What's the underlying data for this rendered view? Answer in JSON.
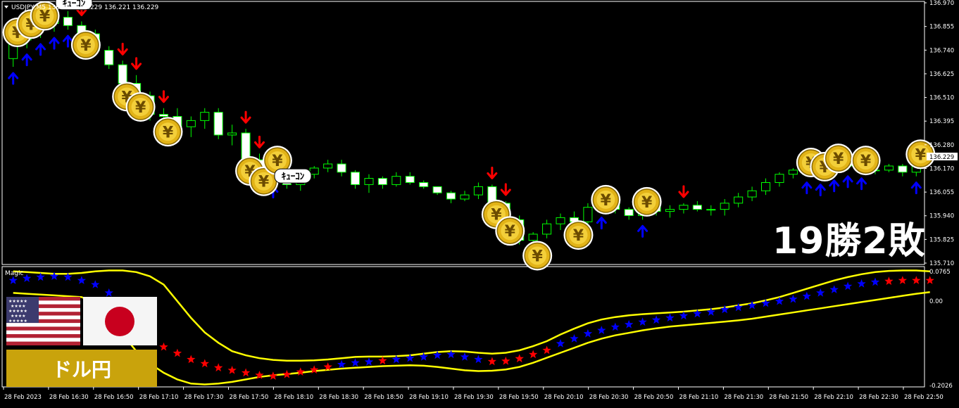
{
  "symbol_header": "USDJPY,M5  136.222 136.229 136.221 136.229",
  "main_price_labels": [
    "136.970",
    "136.855",
    "136.740",
    "136.625",
    "136.510",
    "136.395",
    "136.280",
    "136.170",
    "136.055",
    "135.940",
    "135.825",
    "135.710"
  ],
  "current_price": "136.229",
  "indicator_name": "Magic",
  "indicator_labels": [
    "0.0765",
    "0.00",
    "-0.2026"
  ],
  "time_labels": [
    "28 Feb 2023",
    "28 Feb 16:30",
    "28 Feb 16:50",
    "28 Feb 17:10",
    "28 Feb 17:30",
    "28 Feb 17:50",
    "28 Feb 18:10",
    "28 Feb 18:30",
    "28 Feb 18:50",
    "28 Feb 19:10",
    "28 Feb 19:30",
    "28 Feb 19:50",
    "28 Feb 20:10",
    "28 Feb 20:30",
    "28 Feb 20:50",
    "28 Feb 21:10",
    "28 Feb 21:30",
    "28 Feb 21:50",
    "28 Feb 22:10",
    "28 Feb 22:30",
    "28 Feb 22:50"
  ],
  "result_text": "19勝2敗",
  "pair_badge": "ドル円",
  "coin_symbol": "¥",
  "coin_caption": "ｷｭｰｺﾝ",
  "colors": {
    "background": "#000000",
    "candle_up": "#00ff00",
    "candle_down_fill": "#ffffff",
    "buy_arrow": "#0000ff",
    "sell_arrow": "#ff0000",
    "band": "#ffff00",
    "badge": "#c9a30c"
  },
  "chart_data": {
    "type": "candlestick",
    "y_range": [
      135.71,
      136.97
    ],
    "candles": [
      [
        136.7,
        136.82,
        136.66,
        136.79
      ],
      [
        136.79,
        136.86,
        136.75,
        136.84
      ],
      [
        136.84,
        136.9,
        136.8,
        136.87
      ],
      [
        136.87,
        136.93,
        136.83,
        136.9
      ],
      [
        136.9,
        136.93,
        136.84,
        136.86
      ],
      [
        136.86,
        136.88,
        136.8,
        136.82
      ],
      [
        136.82,
        136.84,
        136.72,
        136.74
      ],
      [
        136.74,
        136.76,
        136.65,
        136.67
      ],
      [
        136.67,
        136.69,
        136.55,
        136.58
      ],
      [
        136.58,
        136.62,
        136.5,
        136.52
      ],
      [
        136.52,
        136.54,
        136.4,
        136.43
      ],
      [
        136.43,
        136.46,
        136.38,
        136.42
      ],
      [
        136.42,
        136.46,
        136.33,
        136.37
      ],
      [
        136.37,
        136.42,
        136.32,
        136.4
      ],
      [
        136.4,
        136.46,
        136.36,
        136.44
      ],
      [
        136.44,
        136.46,
        136.31,
        136.33
      ],
      [
        136.33,
        136.38,
        136.28,
        136.34
      ],
      [
        136.34,
        136.36,
        136.19,
        136.21
      ],
      [
        136.21,
        136.24,
        136.14,
        136.16
      ],
      [
        136.16,
        136.2,
        136.11,
        136.14
      ],
      [
        136.14,
        136.16,
        136.07,
        136.09
      ],
      [
        136.09,
        136.16,
        136.06,
        136.14
      ],
      [
        136.14,
        136.18,
        136.12,
        136.17
      ],
      [
        136.17,
        136.21,
        136.15,
        136.19
      ],
      [
        136.19,
        136.21,
        136.13,
        136.15
      ],
      [
        136.15,
        136.16,
        136.07,
        136.09
      ],
      [
        136.09,
        136.14,
        136.05,
        136.12
      ],
      [
        136.12,
        136.13,
        136.07,
        136.09
      ],
      [
        136.09,
        136.15,
        136.08,
        136.13
      ],
      [
        136.13,
        136.15,
        136.09,
        136.1
      ],
      [
        136.1,
        136.11,
        136.07,
        136.08
      ],
      [
        136.08,
        136.08,
        136.04,
        136.05
      ],
      [
        136.05,
        136.06,
        136.0,
        136.02
      ],
      [
        136.02,
        136.06,
        136.01,
        136.04
      ],
      [
        136.04,
        136.1,
        136.02,
        136.08
      ],
      [
        136.08,
        136.09,
        135.98,
        136.0
      ],
      [
        136.0,
        136.01,
        135.9,
        135.92
      ],
      [
        135.92,
        135.94,
        135.8,
        135.82
      ],
      [
        135.82,
        135.86,
        135.78,
        135.85
      ],
      [
        135.85,
        135.92,
        135.83,
        135.9
      ],
      [
        135.9,
        135.95,
        135.87,
        135.93
      ],
      [
        135.93,
        135.96,
        135.88,
        135.91
      ],
      [
        135.91,
        136.0,
        135.9,
        135.98
      ],
      [
        135.98,
        136.01,
        135.96,
        136.0
      ],
      [
        136.0,
        136.01,
        135.95,
        135.97
      ],
      [
        135.97,
        135.98,
        135.92,
        135.94
      ],
      [
        135.94,
        136.0,
        135.92,
        135.99
      ],
      [
        135.99,
        136.0,
        135.94,
        135.96
      ],
      [
        135.96,
        135.99,
        135.93,
        135.97
      ],
      [
        135.97,
        136.0,
        135.95,
        135.99
      ],
      [
        135.99,
        136.01,
        135.96,
        135.97
      ],
      [
        135.97,
        135.99,
        135.94,
        135.97
      ],
      [
        135.97,
        136.02,
        135.94,
        136.0
      ],
      [
        136.0,
        136.05,
        135.98,
        136.03
      ],
      [
        136.03,
        136.08,
        136.01,
        136.06
      ],
      [
        136.06,
        136.12,
        136.04,
        136.1
      ],
      [
        136.1,
        136.15,
        136.08,
        136.14
      ],
      [
        136.14,
        136.17,
        136.12,
        136.16
      ],
      [
        136.16,
        136.19,
        136.13,
        136.14
      ],
      [
        136.14,
        136.17,
        136.12,
        136.16
      ],
      [
        136.16,
        136.21,
        136.14,
        136.19
      ],
      [
        136.19,
        136.23,
        136.16,
        136.18
      ],
      [
        136.18,
        136.2,
        136.15,
        136.16
      ],
      [
        136.16,
        136.18,
        136.14,
        136.16
      ],
      [
        136.16,
        136.19,
        136.15,
        136.18
      ],
      [
        136.18,
        136.19,
        136.13,
        136.15
      ],
      [
        136.15,
        136.23,
        136.13,
        136.2
      ]
    ],
    "buy_signal_indices": [
      0,
      1,
      2,
      3,
      4,
      19,
      43,
      46,
      58,
      59,
      60,
      61,
      62,
      66
    ],
    "sell_signal_indices": [
      5,
      8,
      9,
      11,
      17,
      18,
      35,
      36,
      49
    ],
    "indicator_range": [
      -0.2026,
      0.0765
    ],
    "indicator_values": [
      0.05,
      0.055,
      0.058,
      0.06,
      0.058,
      0.05,
      0.04,
      0.02,
      -0.02,
      -0.06,
      -0.09,
      -0.11,
      -0.125,
      -0.14,
      -0.15,
      -0.16,
      -0.166,
      -0.172,
      -0.178,
      -0.18,
      -0.176,
      -0.17,
      -0.165,
      -0.158,
      -0.152,
      -0.148,
      -0.146,
      -0.143,
      -0.14,
      -0.137,
      -0.134,
      -0.13,
      -0.128,
      -0.134,
      -0.14,
      -0.145,
      -0.144,
      -0.138,
      -0.128,
      -0.118,
      -0.102,
      -0.09,
      -0.078,
      -0.07,
      -0.062,
      -0.056,
      -0.05,
      -0.045,
      -0.04,
      -0.035,
      -0.03,
      -0.026,
      -0.02,
      -0.015,
      -0.01,
      -0.005,
      0.0,
      0.005,
      0.012,
      0.02,
      0.028,
      0.036,
      0.042,
      0.046,
      0.048,
      0.05,
      0.05,
      0.05
    ],
    "indicator_star_colors_red_indices": [
      8,
      9,
      10,
      11,
      12,
      13,
      14,
      15,
      16,
      17,
      18,
      19,
      20,
      21,
      22,
      23,
      27,
      35,
      36,
      37,
      38,
      39,
      64,
      65,
      66,
      67
    ],
    "upper_band": [
      0.072,
      0.07,
      0.068,
      0.066,
      0.066,
      0.068,
      0.072,
      0.074,
      0.074,
      0.07,
      0.06,
      0.04,
      0.0,
      -0.04,
      -0.075,
      -0.1,
      -0.12,
      -0.13,
      -0.137,
      -0.141,
      -0.143,
      -0.143,
      -0.142,
      -0.14,
      -0.137,
      -0.134,
      -0.133,
      -0.133,
      -0.132,
      -0.13,
      -0.126,
      -0.122,
      -0.12,
      -0.121,
      -0.124,
      -0.126,
      -0.124,
      -0.118,
      -0.108,
      -0.096,
      -0.08,
      -0.066,
      -0.053,
      -0.044,
      -0.038,
      -0.034,
      -0.031,
      -0.029,
      -0.027,
      -0.025,
      -0.022,
      -0.019,
      -0.015,
      -0.01,
      -0.005,
      0.002,
      0.01,
      0.02,
      0.03,
      0.04,
      0.05,
      0.058,
      0.065,
      0.07,
      0.073,
      0.074,
      0.074,
      0.072
    ],
    "lower_band": [
      0.02,
      0.018,
      0.016,
      0.014,
      0.012,
      0.01,
      -0.005,
      -0.04,
      -0.08,
      -0.12,
      -0.15,
      -0.172,
      -0.188,
      -0.198,
      -0.2,
      -0.198,
      -0.194,
      -0.188,
      -0.182,
      -0.178,
      -0.175,
      -0.172,
      -0.168,
      -0.165,
      -0.162,
      -0.16,
      -0.158,
      -0.156,
      -0.155,
      -0.154,
      -0.155,
      -0.158,
      -0.162,
      -0.166,
      -0.168,
      -0.167,
      -0.164,
      -0.158,
      -0.148,
      -0.136,
      -0.124,
      -0.112,
      -0.1,
      -0.09,
      -0.082,
      -0.076,
      -0.07,
      -0.065,
      -0.061,
      -0.058,
      -0.055,
      -0.052,
      -0.049,
      -0.046,
      -0.042,
      -0.037,
      -0.032,
      -0.027,
      -0.022,
      -0.017,
      -0.012,
      -0.007,
      -0.002,
      0.003,
      0.008,
      0.013,
      0.018,
      0.022
    ]
  }
}
